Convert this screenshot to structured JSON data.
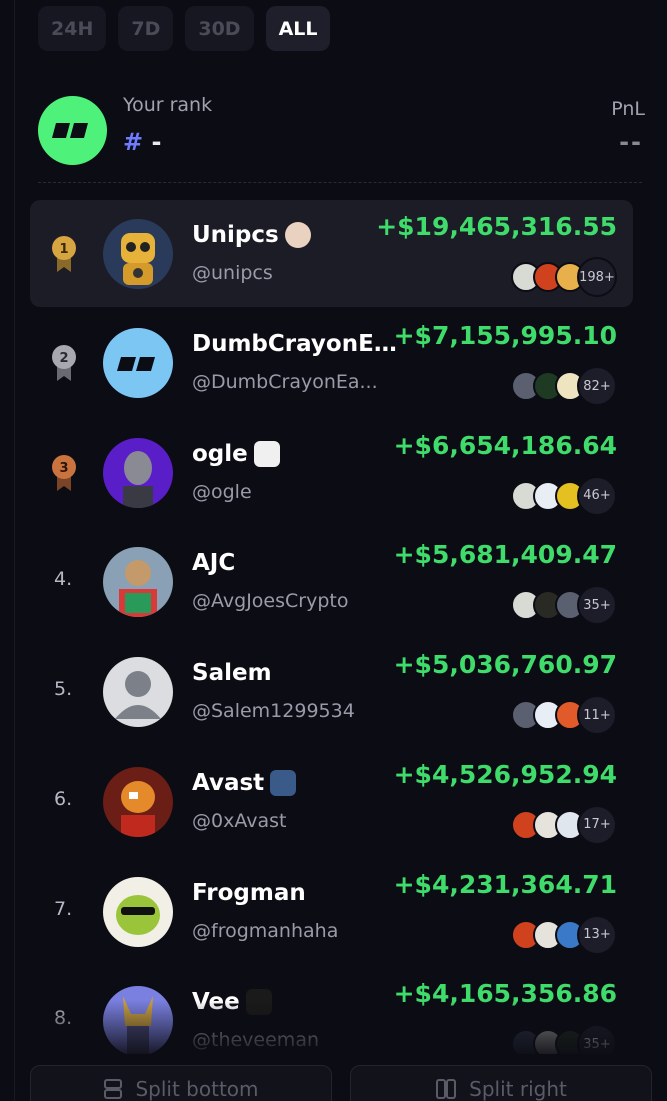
{
  "tabs": [
    {
      "label": "24H",
      "active": false
    },
    {
      "label": "7D",
      "active": false
    },
    {
      "label": "30D",
      "active": false
    },
    {
      "label": "ALL",
      "active": true
    }
  ],
  "your_rank": {
    "label": "Your rank",
    "hash": "#",
    "value": "-",
    "pnl_label": "PnL",
    "pnl_value": "--"
  },
  "leaderboard": [
    {
      "rank": "1",
      "name": "Unipcs",
      "handle": "@unipcs",
      "pnl": "+$19,465,316.55",
      "count": "198+"
    },
    {
      "rank": "2",
      "name": "DumbCrayonEa...",
      "handle": "@DumbCrayonEa...",
      "pnl": "+$7,155,995.10",
      "count": "82+"
    },
    {
      "rank": "3",
      "name": "ogle",
      "handle": "@ogle",
      "pnl": "+$6,654,186.64",
      "count": "46+"
    },
    {
      "rank": "4.",
      "name": "AJC",
      "handle": "@AvgJoesCrypto",
      "pnl": "+$5,681,409.47",
      "count": "35+"
    },
    {
      "rank": "5.",
      "name": "Salem",
      "handle": "@Salem1299534",
      "pnl": "+$5,036,760.97",
      "count": "11+"
    },
    {
      "rank": "6.",
      "name": "Avast",
      "handle": "@0xAvast",
      "pnl": "+$4,526,952.94",
      "count": "17+"
    },
    {
      "rank": "7.",
      "name": "Frogman",
      "handle": "@frogmanhaha",
      "pnl": "+$4,231,364.71",
      "count": "13+"
    },
    {
      "rank": "8.",
      "name": "Vee",
      "handle": "@theveeman",
      "pnl": "+$4,165,356.86",
      "count": "35+"
    }
  ],
  "footer": {
    "split_bottom": "Split bottom",
    "split_right": "Split right"
  },
  "colors": {
    "positive": "#3fdb6b",
    "accent": "#6f7cff",
    "brand": "#4ef27a"
  }
}
